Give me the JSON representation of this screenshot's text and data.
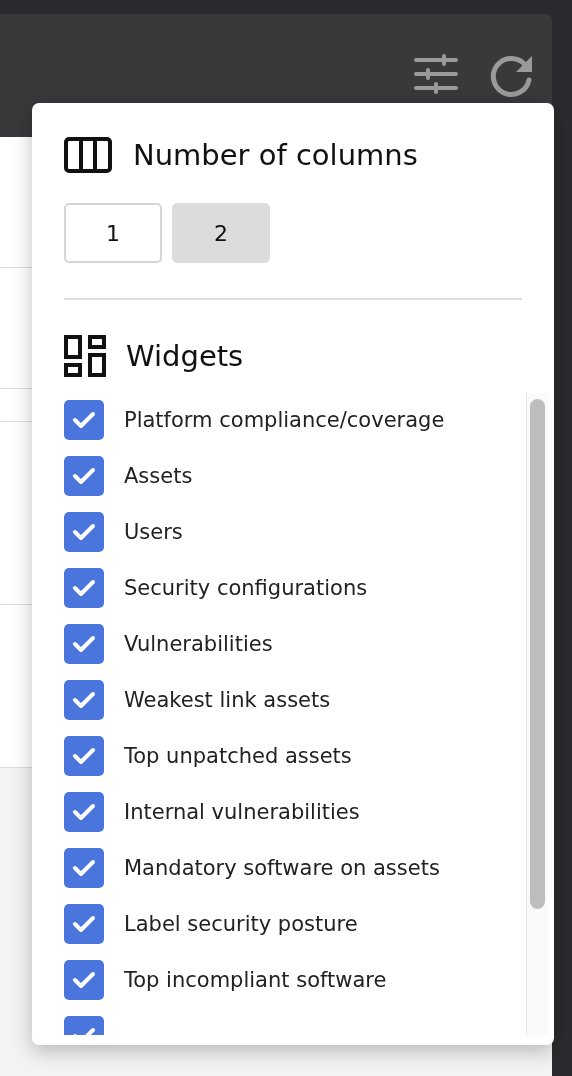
{
  "columns_section": {
    "title": "Number of columns",
    "options": [
      {
        "label": "1",
        "selected": false
      },
      {
        "label": "2",
        "selected": true
      }
    ]
  },
  "widgets_section": {
    "title": "Widgets",
    "items": [
      {
        "label": "Platform compliance/coverage",
        "checked": true
      },
      {
        "label": "Assets",
        "checked": true
      },
      {
        "label": "Users",
        "checked": true
      },
      {
        "label": "Security configurations",
        "checked": true
      },
      {
        "label": "Vulnerabilities",
        "checked": true
      },
      {
        "label": "Weakest link assets",
        "checked": true
      },
      {
        "label": "Top unpatched assets",
        "checked": true
      },
      {
        "label": "Internal vulnerabilities",
        "checked": true
      },
      {
        "label": "Mandatory software on assets",
        "checked": true
      },
      {
        "label": "Label security posture",
        "checked": true
      },
      {
        "label": "Top incompliant software",
        "checked": true
      },
      {
        "checked": true
      }
    ]
  }
}
